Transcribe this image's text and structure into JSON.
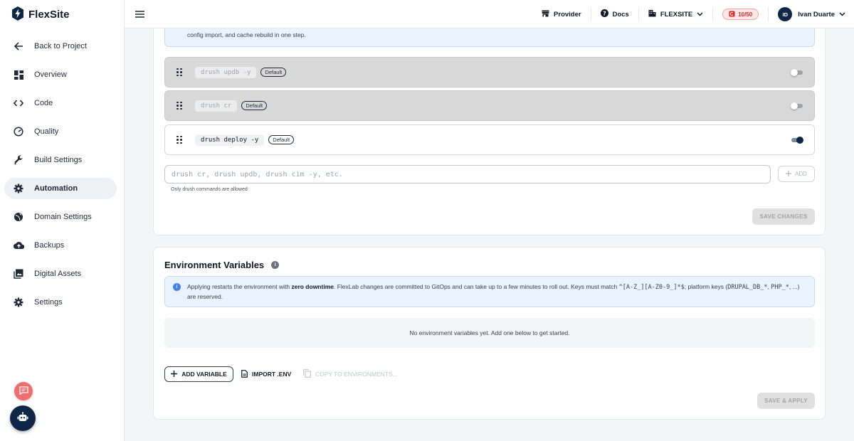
{
  "brand": {
    "name": "FlexSite",
    "logo_icon": "bolt-shield-icon"
  },
  "sidebar": {
    "items": [
      {
        "label": "Back to Project",
        "icon": "arrow-left-icon",
        "active": false
      },
      {
        "label": "Overview",
        "icon": "dashboard-icon",
        "active": false
      },
      {
        "label": "Code",
        "icon": "code-icon",
        "active": false
      },
      {
        "label": "Quality",
        "icon": "gauge-icon",
        "active": false
      },
      {
        "label": "Build Settings",
        "icon": "wrench-icon",
        "active": false
      },
      {
        "label": "Automation",
        "icon": "gear-icon",
        "active": true
      },
      {
        "label": "Domain Settings",
        "icon": "globe-icon",
        "active": false
      },
      {
        "label": "Backups",
        "icon": "cloud-upload-icon",
        "active": false
      },
      {
        "label": "Digital Assets",
        "icon": "image-gallery-icon",
        "active": false
      },
      {
        "label": "Settings",
        "icon": "gear-icon",
        "active": false
      }
    ]
  },
  "topbar": {
    "provider_label": "Provider",
    "docs_label": "Docs",
    "site_label": "FLEXSITE",
    "quota_label": "10/50",
    "user_initials": "ID",
    "user_name": "Ivan Duarte"
  },
  "automation": {
    "info_text": "config import, and cache rebuild in one step.",
    "commands": [
      {
        "command": "drush updb -y",
        "badge": "Default",
        "enabled": false
      },
      {
        "command": "drush cr",
        "badge": "Default",
        "enabled": false
      },
      {
        "command": "drush deploy -y",
        "badge": "Default",
        "enabled": true
      }
    ],
    "input_placeholder": "drush cr, drush updb, drush cim -y, etc.",
    "input_value": "",
    "add_label": "ADD",
    "hint": "Only drush commands are allowed",
    "save_label": "SAVE CHANGES"
  },
  "env": {
    "title": "Environment Variables",
    "info_prefix": "Applying restarts the environment with ",
    "info_bold": "zero downtime",
    "info_mid": ". FlexLab changes are committed to GitOps and can take up to a few minutes to roll out. Keys must match ",
    "info_code": "^[A-Z_][A-Z0-9_]*$",
    "info_mid2": "; platform keys (",
    "info_code2": "DRUPAL_DB_*",
    "info_comma": ", ",
    "info_code3": "PHP_*",
    "info_suffix": ", ...) are reserved.",
    "empty_text": "No environment variables yet. Add one below to get started.",
    "add_variable_label": "ADD VARIABLE",
    "import_label": "IMPORT .ENV",
    "copy_label": "COPY TO ENVIRONMENTS...",
    "save_apply_label": "SAVE & APPLY"
  },
  "colors": {
    "accent": "#0f2747",
    "info_bg": "#eaf2fd",
    "danger": "#dc2626",
    "fab": "#f06e6e"
  }
}
